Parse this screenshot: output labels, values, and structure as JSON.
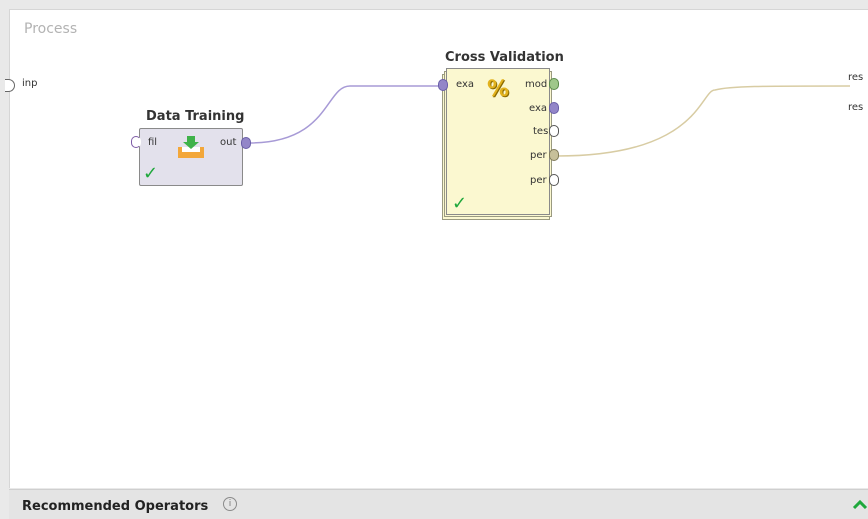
{
  "process": {
    "title": "Process",
    "left_ports": [
      {
        "label": "inp"
      }
    ],
    "right_ports": [
      {
        "label": "res"
      },
      {
        "label": "res"
      }
    ]
  },
  "operators": {
    "data_training": {
      "name": "Data Training",
      "in_port": "fil",
      "out_port": "out",
      "icon": "retrieve-data-icon",
      "status": "ok"
    },
    "cross_validation": {
      "name": "Cross Validation",
      "in_port": "exa",
      "out_ports": [
        {
          "label": "mod"
        },
        {
          "label": "exa"
        },
        {
          "label": "tes"
        },
        {
          "label": "per"
        },
        {
          "label": "per"
        }
      ],
      "icon": "percent-icon",
      "status": "ok"
    }
  },
  "bottom": {
    "label": "Recommended Operators",
    "info_icon": "info-icon",
    "toggle_icon": "chevron-up-icon"
  },
  "colors": {
    "example_set_port": "#9386c8",
    "model_port": "#9fc78a",
    "performance_port": "#c7c09a",
    "validation_fill": "#fbf8d0",
    "training_fill": "#e3e1ec",
    "check": "#1fa83c"
  }
}
